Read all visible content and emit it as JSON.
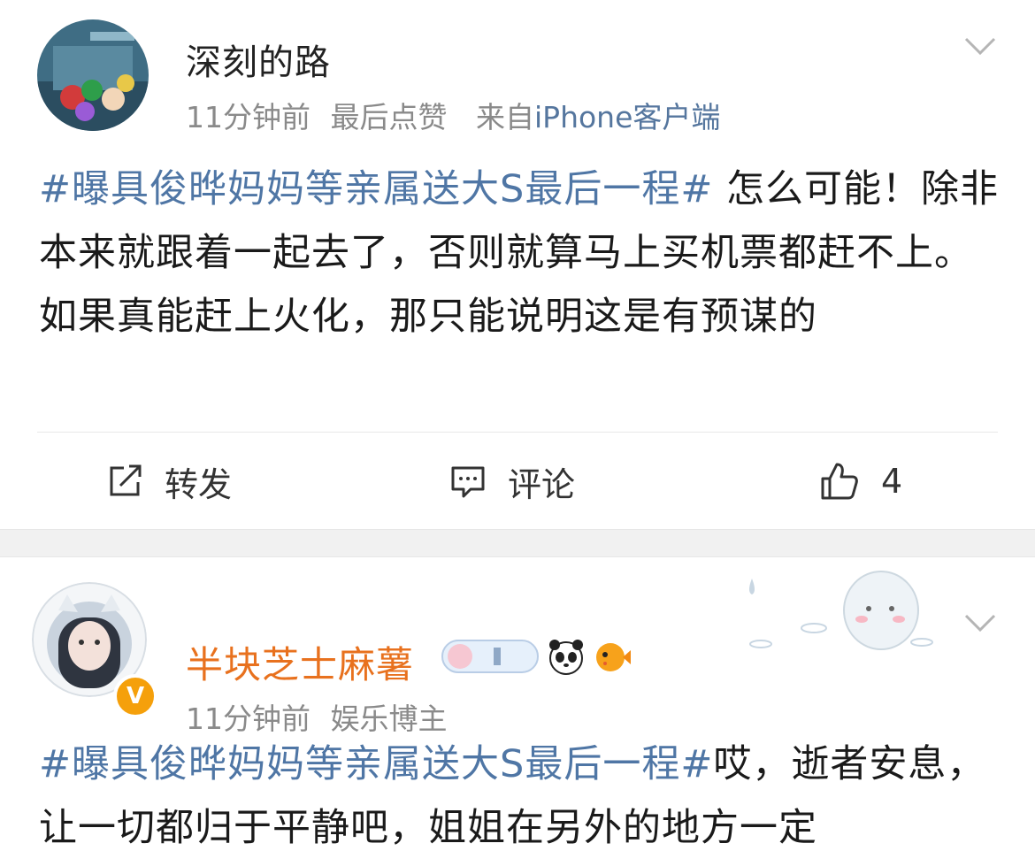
{
  "post1": {
    "username": "深刻的路",
    "time": "11分钟前",
    "activity": "最后点赞",
    "source_prefix": "来自",
    "source": "iPhone客户端",
    "topic": "#曝具俊晔妈妈等亲属送大S最后一程#",
    "text": " 怎么可能！除非本来就跟着一起去了，否则就算马上买机票都赶不上。如果真能赶上火化，那只能说明这是有预谋的",
    "actions": {
      "repost": "转发",
      "comment": "评论",
      "likes": "4"
    }
  },
  "post2": {
    "username": "半块芝士麻薯",
    "time": "11分钟前",
    "role": "娱乐博主",
    "verified": "V",
    "topic": "#曝具俊晔妈妈等亲属送大S最后一程#",
    "text": "哎，逝者安息，让一切都归于平静吧，姐姐在另外的地方一定"
  },
  "icons": [
    "avatar",
    "chevron-down-icon",
    "repost-icon",
    "comment-icon",
    "like-icon",
    "panda-icon",
    "pufferfish-icon",
    "verified-badge"
  ],
  "colors": {
    "topic": "#4f76a5",
    "username_vip": "#e8711e",
    "meta": "#8a8a8a",
    "badge": "#f5a00b"
  }
}
